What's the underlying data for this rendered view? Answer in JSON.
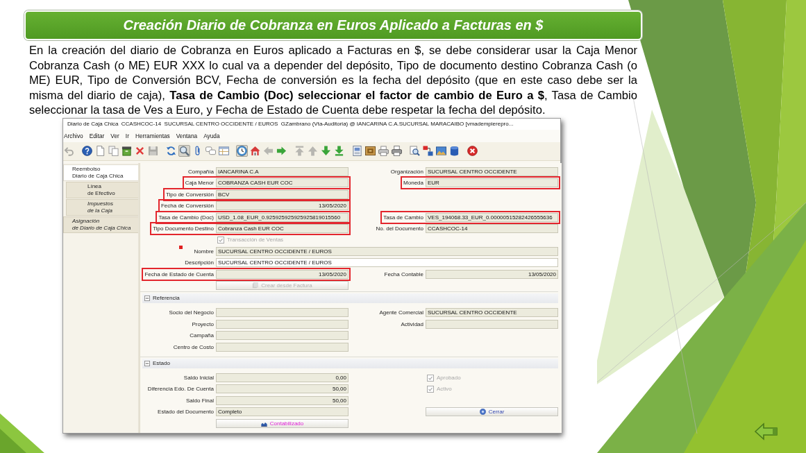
{
  "slide": {
    "title": "Creación Diario de Cobranza en Euros Aplicado a Facturas en $",
    "paragraph": "En la creación del diario de Cobranza en Euros aplicado a Facturas en $, se debe considerar usar la Caja Menor Cobranza Cash (o ME) EUR XXX lo cual va a depender del depósito, Tipo de documento destino Cobranza Cash (o ME) EUR, Tipo de Conversión BCV, Fecha de conversión es la fecha del depósito (que en este caso debe ser la misma del diario de caja), **Tasa de Cambio (Doc) seleccionar el factor de cambio de Euro a $**, Tasa de Cambio seleccionar la tasa de Ves a Euro, y Fecha de Estado de Cuenta debe respetar la fecha del depósito."
  },
  "window": {
    "title": "Diario de Caja Chica  CCASHCOC-14  SUCURSAL CENTRO OCCIDENTE / EUROS  GZambrano (Vta-Auditoria) @ IANCARINA C.A.SUCURSAL MARACAIBO [vmadempierepro...",
    "menu": [
      "Archivo",
      "Editar",
      "Ver",
      "Ir",
      "Herramientas",
      "Ventana",
      "Ayuda"
    ],
    "toolbar": [
      [
        {
          "selected": false,
          "disabled": true
        }
      ],
      [
        {
          "selected": false,
          "disabled": false
        },
        {
          "selected": false,
          "disabled": false
        },
        {
          "selected": false,
          "disabled": false
        },
        {
          "selected": false,
          "disabled": false
        },
        {
          "selected": false,
          "disabled": false
        },
        {
          "selected": false,
          "disabled": true
        }
      ],
      [
        {
          "selected": false,
          "disabled": false
        },
        {
          "selected": true,
          "disabled": false
        },
        {
          "selected": false,
          "disabled": false
        },
        {
          "selected": false,
          "disabled": false
        },
        {
          "selected": false,
          "disabled": false
        }
      ],
      [
        {
          "selected": true,
          "disabled": false
        },
        {
          "selected": false,
          "disabled": false
        },
        {
          "selected": false,
          "disabled": true
        },
        {
          "selected": false,
          "disabled": false
        }
      ],
      [
        {
          "selected": false,
          "disabled": true
        },
        {
          "selected": false,
          "disabled": true
        },
        {
          "selected": false,
          "disabled": false
        },
        {
          "selected": false,
          "disabled": false
        }
      ],
      [
        {
          "selected": false,
          "disabled": false
        },
        {
          "selected": false,
          "disabled": false
        },
        {
          "selected": false,
          "disabled": false
        },
        {
          "selected": false,
          "disabled": false
        }
      ],
      [
        {
          "selected": false,
          "disabled": false
        },
        {
          "selected": false,
          "disabled": false
        },
        {
          "selected": false,
          "disabled": false
        },
        {
          "selected": false,
          "disabled": false
        }
      ],
      [
        {
          "selected": false,
          "disabled": false
        }
      ]
    ],
    "tabs": [
      {
        "label": "Reembolso\nDiario de Caja Chica",
        "selected": true,
        "italic": false,
        "children": [
          {
            "label": "Línea\nde Efectivo",
            "selected": false,
            "italic": false
          },
          {
            "label": "Impuestos\nde la Caja",
            "selected": false,
            "italic": true
          }
        ]
      },
      {
        "label": "Asignación\nde Diario de Caja Chica",
        "selected": false,
        "italic": true
      }
    ],
    "form": {
      "rows": [
        {
          "left": {
            "kind": "text",
            "label": "Compañía",
            "value": "IANCARINA C.A",
            "read_only": true,
            "highlighted": false
          },
          "right": {
            "kind": "text",
            "label": "Organización",
            "value": "SUCURSAL CENTRO OCCIDENTE",
            "read_only": true,
            "highlighted": false
          }
        },
        {
          "left": {
            "kind": "text",
            "label": "Caja Menor",
            "value": "COBRANZA CASH EUR COC",
            "read_only": true,
            "highlighted": true
          },
          "right": {
            "kind": "text",
            "label": "Moneda",
            "value": "EUR",
            "read_only": true,
            "highlighted": true
          }
        },
        {
          "left": {
            "kind": "text",
            "label": "Tipo de Conversión",
            "value": "BCV",
            "read_only": true,
            "highlighted": true
          }
        },
        {
          "left": {
            "kind": "number",
            "label": "Fecha de Conversión",
            "value": "13/05/2020",
            "read_only": true,
            "highlighted": true
          }
        },
        {
          "left": {
            "kind": "text",
            "label": "Tasa de Cambio (Doc)",
            "value": "USD_1.08_EUR_0.925925925925925819015560",
            "read_only": true,
            "highlighted": true
          },
          "right": {
            "kind": "text",
            "label": "Tasa de Cambio",
            "value": "VES_194068.33_EUR_0.00000515282426555636",
            "read_only": true,
            "highlighted": true
          }
        },
        {
          "left": {
            "kind": "text",
            "label": "Tipo Documento Destino",
            "value": "Cobranza Cash EUR COC",
            "read_only": true,
            "highlighted": true
          },
          "right": {
            "kind": "text",
            "label": "No. del Documento",
            "value": "CCASHCOC-14",
            "read_only": true,
            "highlighted": false
          }
        },
        {
          "left": {
            "kind": "checkbox",
            "label": "Transacción de Ventas",
            "checked": true,
            "disabled": true
          }
        },
        {
          "full": {
            "kind": "text",
            "label": "Nombre",
            "value": "SUCURSAL CENTRO OCCIDENTE / EUROS",
            "read_only": true,
            "highlighted": false
          }
        },
        {
          "full": {
            "kind": "text",
            "label": "Descripción",
            "value": "SUCURSAL CENTRO OCCIDENTE / EUROS",
            "read_only": false,
            "highlighted": false
          }
        },
        {
          "left": {
            "kind": "number",
            "label": "Fecha de Estado de Cuenta",
            "value": "13/05/2020",
            "read_only": true,
            "highlighted": true
          },
          "right": {
            "kind": "number",
            "label": "Fecha Contable",
            "value": "13/05/2020",
            "read_only": true,
            "highlighted": false
          }
        },
        {
          "left": {
            "kind": "createfrom",
            "label": "Crear desde Factura",
            "disabled": true
          }
        }
      ],
      "sections": [
        {
          "title": "Referencia",
          "expanded": true,
          "rows": [
            {
              "left": {
                "kind": "text",
                "label": "Socio del Negocio",
                "read_only": true,
                "highlighted": false
              },
              "right": {
                "kind": "text",
                "label": "Agente Comercial",
                "value": "SUCURSAL CENTRO OCCIDENTE",
                "read_only": true,
                "highlighted": false
              }
            },
            {
              "left": {
                "kind": "text",
                "label": "Proyecto",
                "read_only": true,
                "highlighted": false
              },
              "right": {
                "kind": "text",
                "label": "Actividad",
                "read_only": true,
                "highlighted": false
              }
            },
            {
              "left": {
                "kind": "text",
                "label": "Campaña",
                "read_only": true,
                "highlighted": false
              }
            },
            {
              "left": {
                "kind": "text",
                "label": "Centro de Costo",
                "read_only": true,
                "highlighted": false
              }
            }
          ]
        },
        {
          "title": "Estado",
          "expanded": true,
          "rows": [
            {
              "left": {
                "kind": "number",
                "label": "Saldo Inicial",
                "value": "0,00",
                "read_only": true,
                "highlighted": false
              },
              "right": {
                "kind": "checkbox",
                "label": "Aprobado",
                "checked": true,
                "disabled": true
              }
            },
            {
              "left": {
                "kind": "number",
                "label": "Diferencia Edo. De Cuenta",
                "value": "50,00",
                "read_only": true,
                "highlighted": false
              },
              "right": {
                "kind": "checkbox",
                "label": "Activo",
                "checked": true,
                "disabled": true
              }
            },
            {
              "left": {
                "kind": "number",
                "label": "Saldo Final",
                "value": "50,00",
                "read_only": true,
                "highlighted": false
              }
            },
            {
              "left": {
                "kind": "text",
                "label": "Estado del Documento",
                "value": "Completo",
                "read_only": true,
                "highlighted": false
              },
              "right": {
                "kind": "docaction",
                "label": "Cerrar",
                "disabled": false
              }
            },
            {
              "left": {
                "kind": "posted",
                "label": "Contabilizado",
                "disabled": false
              }
            }
          ]
        }
      ]
    }
  }
}
